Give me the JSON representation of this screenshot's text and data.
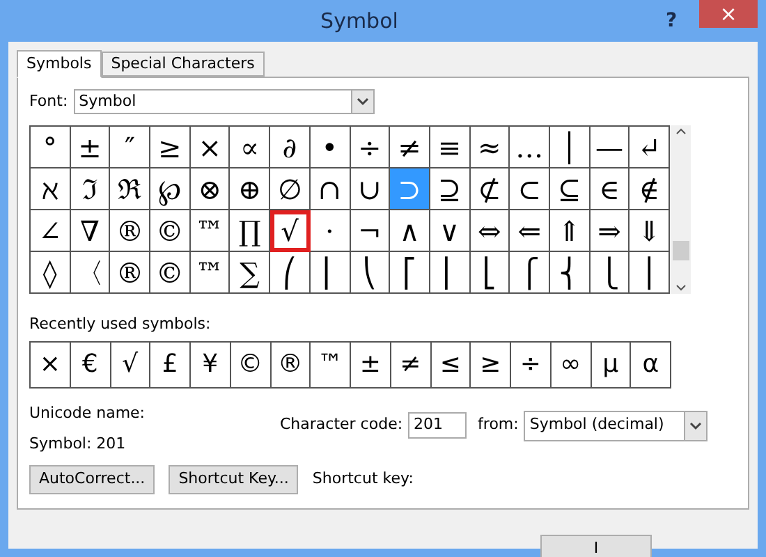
{
  "window": {
    "title": "Symbol",
    "help": "?",
    "close": "×"
  },
  "tabs": [
    {
      "label": "Symbols",
      "selected": true
    },
    {
      "label": "Special Characters",
      "selected": false
    }
  ],
  "font": {
    "label": "Font:",
    "value": "Symbol"
  },
  "grid": [
    [
      {
        "ch": "°",
        "selected": false,
        "highlighted": false
      },
      {
        "ch": "±",
        "selected": false,
        "highlighted": false
      },
      {
        "ch": "″",
        "selected": false,
        "highlighted": false
      },
      {
        "ch": "≥",
        "selected": false,
        "highlighted": false
      },
      {
        "ch": "×",
        "selected": false,
        "highlighted": false
      },
      {
        "ch": "∝",
        "selected": false,
        "highlighted": false
      },
      {
        "ch": "∂",
        "selected": false,
        "highlighted": false
      },
      {
        "ch": "•",
        "selected": false,
        "highlighted": false
      },
      {
        "ch": "÷",
        "selected": false,
        "highlighted": false
      },
      {
        "ch": "≠",
        "selected": false,
        "highlighted": false
      },
      {
        "ch": "≡",
        "selected": false,
        "highlighted": false
      },
      {
        "ch": "≈",
        "selected": false,
        "highlighted": false
      },
      {
        "ch": "…",
        "selected": false,
        "highlighted": false
      },
      {
        "ch": "│",
        "selected": false,
        "highlighted": false
      },
      {
        "ch": "—",
        "selected": false,
        "highlighted": false
      },
      {
        "ch": "↵",
        "selected": false,
        "highlighted": false
      }
    ],
    [
      {
        "ch": "ℵ",
        "selected": false,
        "highlighted": false
      },
      {
        "ch": "ℑ",
        "selected": false,
        "highlighted": false
      },
      {
        "ch": "ℜ",
        "selected": false,
        "highlighted": false
      },
      {
        "ch": "℘",
        "selected": false,
        "highlighted": false
      },
      {
        "ch": "⊗",
        "selected": false,
        "highlighted": false
      },
      {
        "ch": "⊕",
        "selected": false,
        "highlighted": false
      },
      {
        "ch": "∅",
        "selected": false,
        "highlighted": false
      },
      {
        "ch": "∩",
        "selected": false,
        "highlighted": false
      },
      {
        "ch": "∪",
        "selected": false,
        "highlighted": false
      },
      {
        "ch": "⊃",
        "selected": true,
        "highlighted": false
      },
      {
        "ch": "⊇",
        "selected": false,
        "highlighted": false
      },
      {
        "ch": "⊄",
        "selected": false,
        "highlighted": false
      },
      {
        "ch": "⊂",
        "selected": false,
        "highlighted": false
      },
      {
        "ch": "⊆",
        "selected": false,
        "highlighted": false
      },
      {
        "ch": "∈",
        "selected": false,
        "highlighted": false
      },
      {
        "ch": "∉",
        "selected": false,
        "highlighted": false
      }
    ],
    [
      {
        "ch": "∠",
        "selected": false,
        "highlighted": false
      },
      {
        "ch": "∇",
        "selected": false,
        "highlighted": false
      },
      {
        "ch": "®",
        "selected": false,
        "highlighted": false
      },
      {
        "ch": "©",
        "selected": false,
        "highlighted": false
      },
      {
        "ch": "™",
        "selected": false,
        "highlighted": false
      },
      {
        "ch": "∏",
        "selected": false,
        "highlighted": false
      },
      {
        "ch": "√",
        "selected": false,
        "highlighted": true
      },
      {
        "ch": "·",
        "selected": false,
        "highlighted": false
      },
      {
        "ch": "¬",
        "selected": false,
        "highlighted": false
      },
      {
        "ch": "∧",
        "selected": false,
        "highlighted": false
      },
      {
        "ch": "∨",
        "selected": false,
        "highlighted": false
      },
      {
        "ch": "⇔",
        "selected": false,
        "highlighted": false
      },
      {
        "ch": "⇐",
        "selected": false,
        "highlighted": false
      },
      {
        "ch": "⇑",
        "selected": false,
        "highlighted": false
      },
      {
        "ch": "⇒",
        "selected": false,
        "highlighted": false
      },
      {
        "ch": "⇓",
        "selected": false,
        "highlighted": false
      }
    ],
    [
      {
        "ch": "◊",
        "selected": false,
        "highlighted": false
      },
      {
        "ch": "〈",
        "selected": false,
        "highlighted": false
      },
      {
        "ch": "®",
        "selected": false,
        "highlighted": false
      },
      {
        "ch": "©",
        "selected": false,
        "highlighted": false
      },
      {
        "ch": "™",
        "selected": false,
        "highlighted": false
      },
      {
        "ch": "∑",
        "selected": false,
        "highlighted": false
      },
      {
        "ch": "⎛",
        "selected": false,
        "highlighted": false
      },
      {
        "ch": "⎜",
        "selected": false,
        "highlighted": false
      },
      {
        "ch": "⎝",
        "selected": false,
        "highlighted": false
      },
      {
        "ch": "⎡",
        "selected": false,
        "highlighted": false
      },
      {
        "ch": "⎢",
        "selected": false,
        "highlighted": false
      },
      {
        "ch": "⎣",
        "selected": false,
        "highlighted": false
      },
      {
        "ch": "⎧",
        "selected": false,
        "highlighted": false
      },
      {
        "ch": "⎨",
        "selected": false,
        "highlighted": false
      },
      {
        "ch": "⎩",
        "selected": false,
        "highlighted": false
      },
      {
        "ch": "⎪",
        "selected": false,
        "highlighted": false
      }
    ]
  ],
  "recent": {
    "label": "Recently used symbols:",
    "symbols": [
      "×",
      "€",
      "√",
      "£",
      "¥",
      "©",
      "®",
      "™",
      "±",
      "≠",
      "≤",
      "≥",
      "÷",
      "∞",
      "µ",
      "α"
    ]
  },
  "unicode_name": {
    "label": "Unicode name:",
    "value": "Symbol: 201"
  },
  "character_code": {
    "label": "Character code:",
    "value": "201"
  },
  "from": {
    "label": "from:",
    "value": "Symbol (decimal)"
  },
  "buttons": [
    "AutoCorrect...",
    "Shortcut Key..."
  ],
  "shortcut_key": {
    "label": "Shortcut key:"
  },
  "footer_button": "I"
}
